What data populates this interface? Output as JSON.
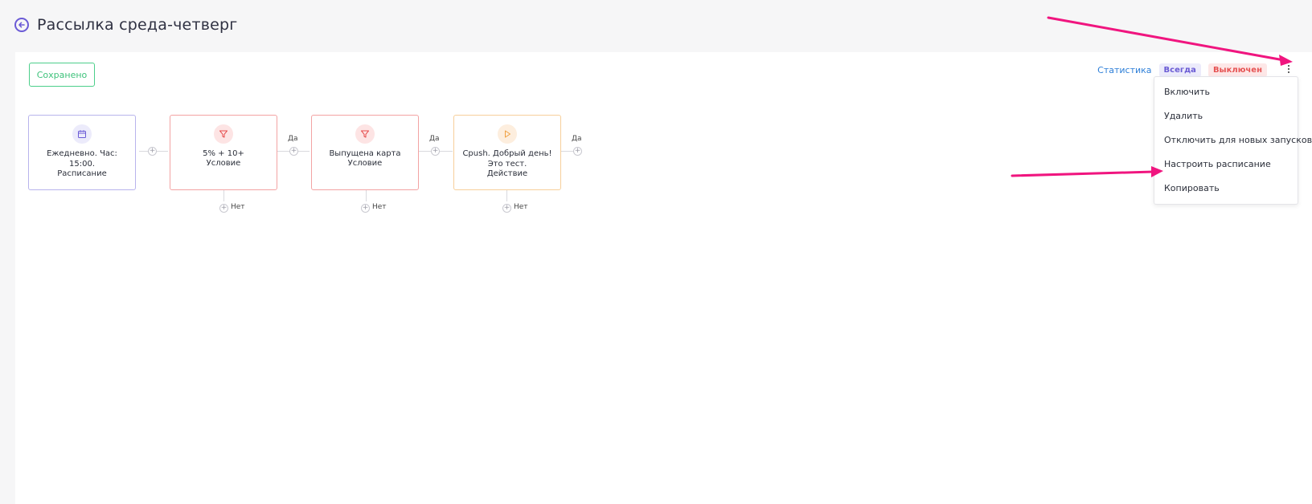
{
  "header": {
    "title": "Рассылка среда-четверг"
  },
  "toolbar": {
    "saved_label": "Сохранено",
    "stats_label": "Статистика",
    "schedule_badge": "Всегда",
    "status_badge": "Выключен"
  },
  "menu": {
    "items": [
      {
        "label": "Включить"
      },
      {
        "label": "Удалить"
      },
      {
        "label": "Отключить для новых запусков"
      },
      {
        "label": "Настроить расписание"
      },
      {
        "label": "Копировать"
      }
    ]
  },
  "flow": {
    "yes_label": "Да",
    "no_label": "Нет",
    "nodes": [
      {
        "kind": "schedule",
        "text": "Ежедневно. Час: 15:00.",
        "type": "Расписание",
        "icon": "calendar-icon"
      },
      {
        "kind": "condition",
        "text": "5% + 10+",
        "type": "Условие",
        "icon": "filter-icon"
      },
      {
        "kind": "condition",
        "text": "Выпущена карта",
        "type": "Условие",
        "icon": "filter-icon"
      },
      {
        "kind": "action",
        "text": "Cpush. Добрый день! Это тест.",
        "type": "Действие",
        "icon": "play-icon"
      }
    ]
  },
  "colors": {
    "accent": "#6b5bd6",
    "saved_green": "#3ec27b",
    "link_blue": "#2e7fd8",
    "annotation_pink": "#f0157f"
  }
}
